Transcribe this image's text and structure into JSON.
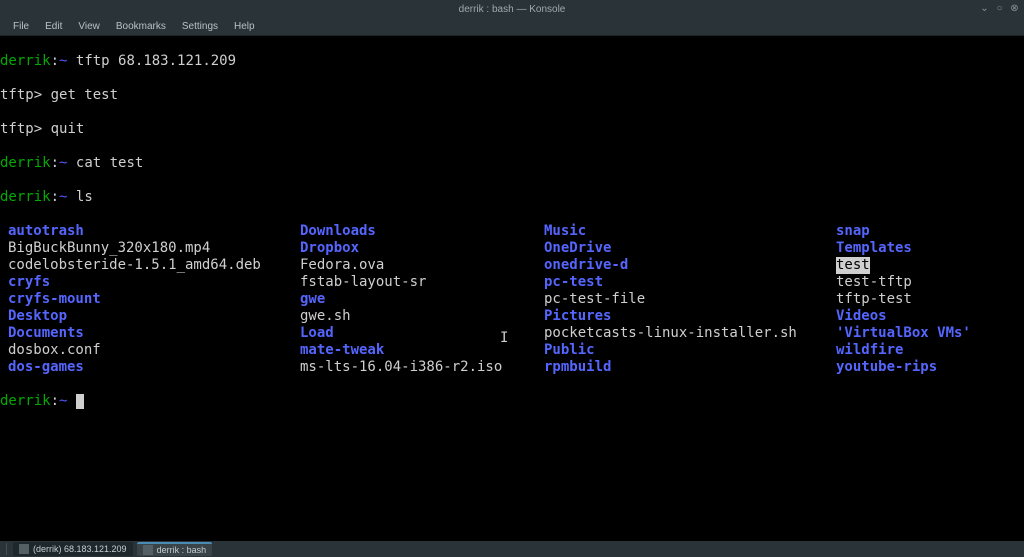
{
  "window": {
    "title": "derrik : bash — Konsole"
  },
  "menu": {
    "file": "File",
    "edit": "Edit",
    "view": "View",
    "bookmarks": "Bookmarks",
    "settings": "Settings",
    "help": "Help"
  },
  "prompt": {
    "user": "derrik",
    "host": "",
    "sep": ":",
    "path": "~",
    "tftp": "tftp>"
  },
  "commands": {
    "tftp": "tftp 68.183.121.209",
    "get": "get test",
    "quit": "quit",
    "cat": "cat test",
    "ls": "ls"
  },
  "ls": {
    "col1": [
      {
        "name": "autotrash",
        "type": "dir"
      },
      {
        "name": "BigBuckBunny_320x180.mp4",
        "type": "file"
      },
      {
        "name": "codelobsteride-1.5.1_amd64.deb",
        "type": "file"
      },
      {
        "name": "cryfs",
        "type": "dir"
      },
      {
        "name": "cryfs-mount",
        "type": "dir"
      },
      {
        "name": "Desktop",
        "type": "dir"
      },
      {
        "name": "Documents",
        "type": "dir"
      },
      {
        "name": "dosbox.conf",
        "type": "file"
      },
      {
        "name": "dos-games",
        "type": "dir"
      }
    ],
    "col2": [
      {
        "name": "Downloads",
        "type": "dir"
      },
      {
        "name": "Dropbox",
        "type": "dir"
      },
      {
        "name": "Fedora.ova",
        "type": "file"
      },
      {
        "name": "fstab-layout-sr",
        "type": "file"
      },
      {
        "name": "gwe",
        "type": "dir"
      },
      {
        "name": "gwe.sh",
        "type": "file"
      },
      {
        "name": "Load",
        "type": "dir"
      },
      {
        "name": "mate-tweak",
        "type": "dir"
      },
      {
        "name": "ms-lts-16.04-i386-r2.iso",
        "type": "file"
      }
    ],
    "col3": [
      {
        "name": "Music",
        "type": "dir"
      },
      {
        "name": "OneDrive",
        "type": "dir"
      },
      {
        "name": "onedrive-d",
        "type": "dir"
      },
      {
        "name": "pc-test",
        "type": "dir"
      },
      {
        "name": "pc-test-file",
        "type": "file"
      },
      {
        "name": "Pictures",
        "type": "dir"
      },
      {
        "name": "pocketcasts-linux-installer.sh",
        "type": "file"
      },
      {
        "name": "Public",
        "type": "dir"
      },
      {
        "name": "rpmbuild",
        "type": "dir"
      }
    ],
    "col4": [
      {
        "name": "snap",
        "type": "dir"
      },
      {
        "name": "Templates",
        "type": "dir"
      },
      {
        "name": "test",
        "type": "highlight"
      },
      {
        "name": "test-tftp",
        "type": "file"
      },
      {
        "name": "tftp-test",
        "type": "file"
      },
      {
        "name": "Videos",
        "type": "dir"
      },
      {
        "name": "'VirtualBox VMs'",
        "type": "dir"
      },
      {
        "name": "wildfire",
        "type": "dir"
      },
      {
        "name": "youtube-rips",
        "type": "dir"
      }
    ]
  },
  "taskbar": {
    "item1": "(derrik) 68.183.121.209",
    "item2": "derrik : bash"
  }
}
